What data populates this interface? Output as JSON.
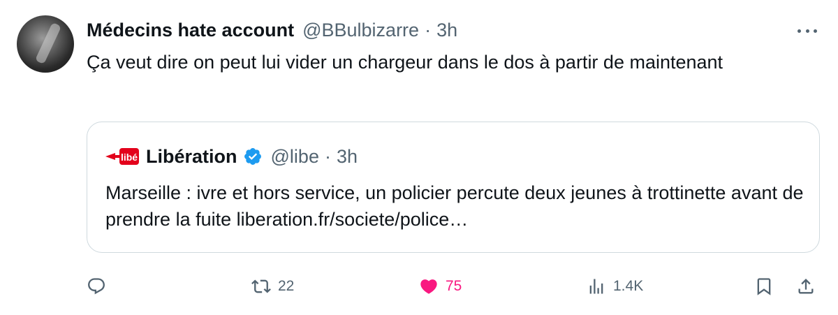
{
  "tweet": {
    "display_name": "Médecins hate account",
    "handle": "@BBulbizarre",
    "separator": "·",
    "time": "3h",
    "text": "Ça veut dire on peut lui vider un chargeur dans le dos à partir de maintenant"
  },
  "quote": {
    "display_name": "Libération",
    "handle": "@libe",
    "separator": "·",
    "time": "3h",
    "text": "Marseille : ivre et hors service, un policier percute deux jeunes à trottinette avant de prendre la fuite liberation.fr/societe/police…",
    "verified": true,
    "logo_text": "libé"
  },
  "actions": {
    "reply_count": "",
    "retweet_count": "22",
    "like_count": "75",
    "views_count": "1.4K",
    "liked": true
  },
  "colors": {
    "text": "#0f1419",
    "secondary": "#536471",
    "like": "#f91880",
    "verified": "#1d9bf0",
    "border": "#cfd9de",
    "libe_red": "#e3001b"
  },
  "icons": [
    "avatar",
    "more-icon",
    "libe-logo",
    "verified-badge-icon",
    "reply-icon",
    "retweet-icon",
    "heart-icon",
    "views-icon",
    "bookmark-icon",
    "share-icon"
  ]
}
